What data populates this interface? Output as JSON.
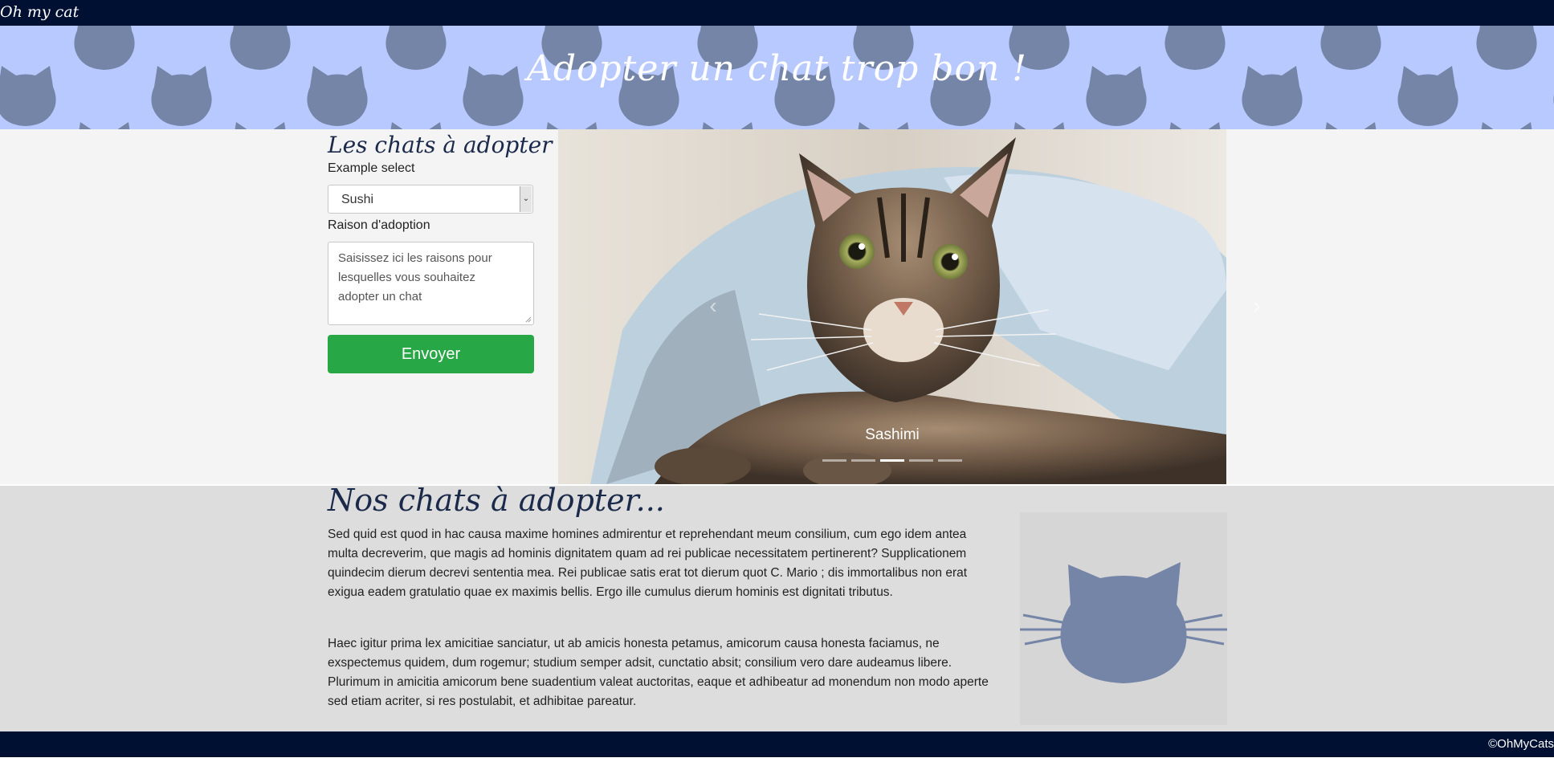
{
  "navbar": {
    "brand": "Oh my cat"
  },
  "hero": {
    "title": "Adopter un chat trop bon !"
  },
  "adoption_form": {
    "title": "Les chats à adopter",
    "select_label": "Example select",
    "select_value": "Sushi",
    "reason_label": "Raison d'adoption",
    "reason_placeholder": "Saisissez ici les raisons pour lesquelles vous souhaitez adopter un chat",
    "submit_label": "Envoyer"
  },
  "carousel": {
    "caption": "Sashimi",
    "prev_icon": "chevron-left-icon",
    "next_icon": "chevron-right-icon",
    "indicator_count": 5,
    "active_index": 2
  },
  "about": {
    "title": "Nos chats à adopter...",
    "paragraph_1": "Sed quid est quod in hac causa maxime homines admirentur et reprehendant meum consilium, cum ego idem antea multa decreverim, que magis ad hominis dignitatem quam ad rei publicae necessitatem pertinerent? Supplicationem quindecim dierum decrevi sententia mea. Rei publicae satis erat tot dierum quot C. Mario ; dis immortalibus non erat exigua eadem gratulatio quae ex maximis bellis. Ergo ille cumulus dierum hominis est dignitati tributus.",
    "paragraph_2": "Haec igitur prima lex amicitiae sanciatur, ut ab amicis honesta petamus, amicorum causa honesta faciamus, ne exspectemus quidem, dum rogemur; studium semper adsit, cunctatio absit; consilium vero dare audeamus libere. Plurimum in amicitia amicorum bene suadentium valeat auctoritas, eaque et adhibeatur ad monendum non modo aperte sed etiam acriter, si res postulabit, et adhibitae pareatur."
  },
  "footer": {
    "copyright": "©OhMyCats"
  },
  "colors": {
    "navbar": "#001033",
    "hero_bg": "#b8c9ff",
    "cat_silhouette": "#7585a8",
    "button_green": "#27a745",
    "title_navy": "#1b2a4a"
  }
}
